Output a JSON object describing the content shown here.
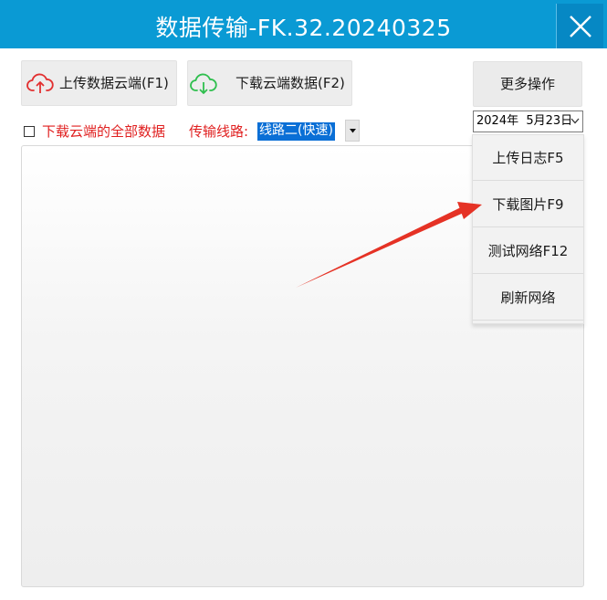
{
  "window": {
    "title": "数据传输-FK.32.20240325",
    "close_icon": "close-icon"
  },
  "toolbar": {
    "upload_label": "上传数据云端(F1)",
    "upload_icon": "cloud-upload-icon",
    "download_label": "下载云端数据(F2)",
    "download_icon": "cloud-download-icon",
    "more_label": "更多操作"
  },
  "date_picker": {
    "value": "2024年  5月23日"
  },
  "options": {
    "download_all_label": "下载云端的全部数据",
    "download_all_checked": false,
    "route_label": "传输线路:",
    "route_value": "线路二(快速)"
  },
  "menu": {
    "items": [
      {
        "label": "上传日志F5"
      },
      {
        "label": "下载图片F9"
      },
      {
        "label": "测试网络F12"
      },
      {
        "label": "刷新网络"
      }
    ]
  },
  "colors": {
    "titlebar": "#0a9ad4",
    "accent_red": "#e02020",
    "upload_icon": "#e23030",
    "download_icon": "#2fbf4e",
    "selection": "#0a6fd6"
  }
}
